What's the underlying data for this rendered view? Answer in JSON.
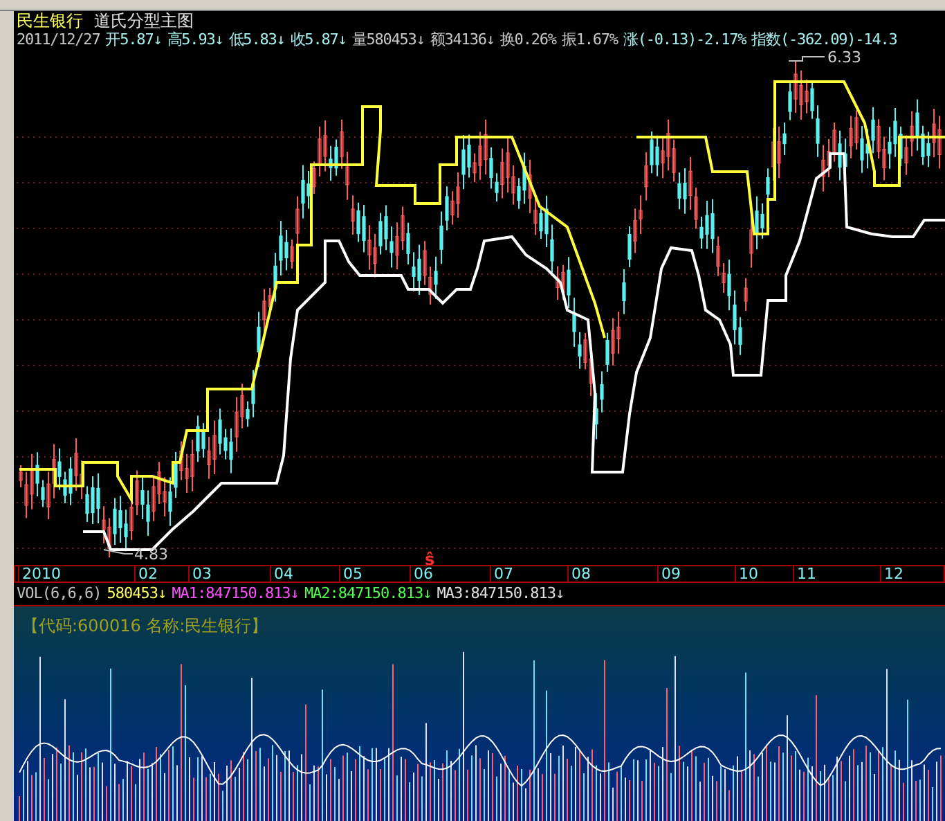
{
  "title": {
    "stock": "民生银行",
    "template": "道氏分型主图"
  },
  "quote_bar": [
    {
      "text": "2011/12/27",
      "color": "#c8c8c8"
    },
    {
      "text": "开5.87↓",
      "color": "#a8f0f0"
    },
    {
      "text": "高5.93↓",
      "color": "#a8f0f0"
    },
    {
      "text": "低5.83↓",
      "color": "#a8f0f0"
    },
    {
      "text": "收5.87↓",
      "color": "#a8f0f0"
    },
    {
      "text": "量580453↓",
      "color": "#c8c8c8"
    },
    {
      "text": "额34136↓",
      "color": "#c8c8c8"
    },
    {
      "text": "换0.26%",
      "color": "#c8c8c8"
    },
    {
      "text": "振1.67%",
      "color": "#c8c8c8"
    },
    {
      "text": "涨(-0.13)-2.17%",
      "color": "#a8f0f0"
    },
    {
      "text": "指数(-362.09)-14.3",
      "color": "#a8f0f0"
    }
  ],
  "price_chart": {
    "high_label": "6.33",
    "low_label": "4.83",
    "signal_mark": "ŝ"
  },
  "time_axis": [
    "2010",
    "02",
    "03",
    "04",
    "05",
    "06",
    "07",
    "08",
    "09",
    "10",
    "11",
    "12"
  ],
  "indicator_bar": [
    {
      "text": "VOL(6,6,6)",
      "color": "#c0c0c0"
    },
    {
      "text": "580453↓",
      "color": "#ffff60"
    },
    {
      "text": "MA1:847150.813↓",
      "color": "#ff50ff"
    },
    {
      "text": "MA2:847150.813↓",
      "color": "#50ff50"
    },
    {
      "text": "MA3:847150.813↓",
      "color": "#e0e0e0"
    }
  ],
  "volume_panel": {
    "caption": "【代码:600016 名称:民生银行】"
  }
}
